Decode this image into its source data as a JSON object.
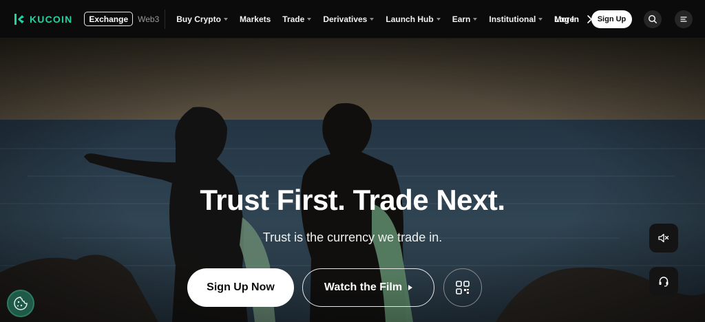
{
  "brand": {
    "name": "KUCOIN",
    "color": "#1fd4a0"
  },
  "mode_switch": {
    "active": "Exchange",
    "inactive": "Web3"
  },
  "nav": {
    "items": [
      {
        "label": "Buy Crypto",
        "has_dropdown": true
      },
      {
        "label": "Markets",
        "has_dropdown": false
      },
      {
        "label": "Trade",
        "has_dropdown": true
      },
      {
        "label": "Derivatives",
        "has_dropdown": true
      },
      {
        "label": "Launch Hub",
        "has_dropdown": true
      },
      {
        "label": "Earn",
        "has_dropdown": true
      },
      {
        "label": "Institutional",
        "has_dropdown": true
      },
      {
        "label": "More",
        "has_dropdown": false
      }
    ],
    "more_arrow_icon": "chevron-right-icon",
    "login": "Log In",
    "signup": "Sign Up",
    "search_icon": "search-icon",
    "menu_icon": "menu-icon"
  },
  "hero": {
    "title": "Trust First. Trade Next.",
    "subtitle": "Trust is the currency we trade in.",
    "cta_primary": "Sign Up Now",
    "cta_secondary": "Watch the Film",
    "qr_icon": "qr-code-icon"
  },
  "side_controls": {
    "mute_icon": "speaker-muted-icon",
    "support_icon": "headset-icon"
  },
  "cookie_icon": "cookie-icon",
  "colors": {
    "nav_bg": "#0b0b0b",
    "accent": "#1fd4a0",
    "cookie_bg": "#1e5a47"
  }
}
